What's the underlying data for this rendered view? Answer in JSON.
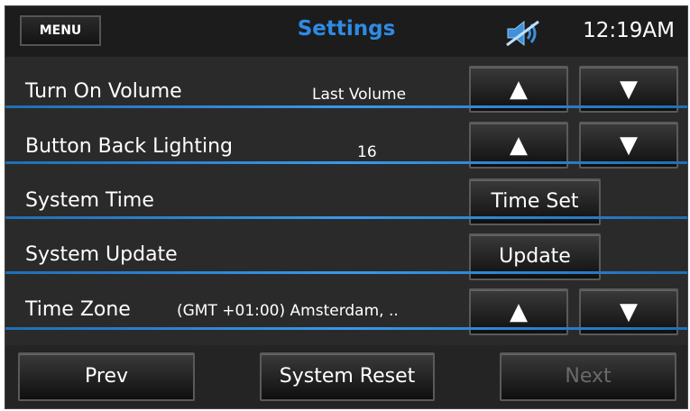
{
  "header": {
    "menu_label": "MENU",
    "title": "Settings",
    "time": "12:19AM",
    "status_icon": "mute-speaker-icon",
    "title_color": "#2e8be6"
  },
  "rows": [
    {
      "label": "Turn On Volume",
      "value": "Last Volume",
      "control": "stepper"
    },
    {
      "label": "Button Back Lighting",
      "value": "16",
      "control": "stepper"
    },
    {
      "label": "System Time",
      "button_label": "Time Set",
      "control": "button"
    },
    {
      "label": "System Update",
      "button_label": "Update",
      "control": "button"
    },
    {
      "label": "Time Zone",
      "value": "(GMT +01:00) Amsterdam, ..",
      "control": "stepper"
    }
  ],
  "stepper": {
    "up": "▲",
    "down": "▼"
  },
  "footer": {
    "prev_label": "Prev",
    "reset_label": "System Reset",
    "next_label": "Next"
  },
  "accent_color": "#2e8be6"
}
